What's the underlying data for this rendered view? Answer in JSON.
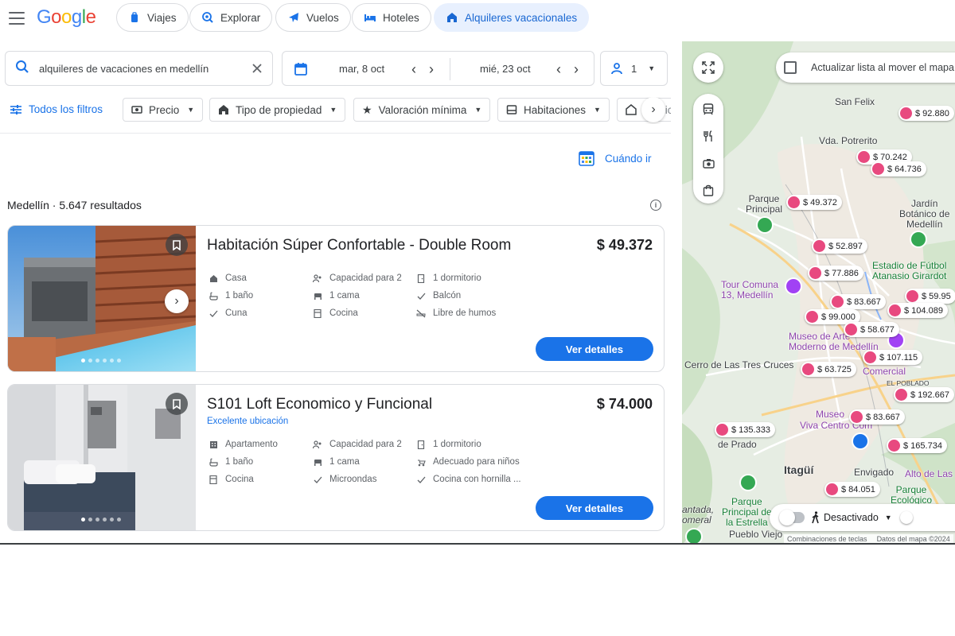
{
  "header": {
    "logo": "Google",
    "nav": [
      {
        "label": "Viajes",
        "icon": "suitcase-icon"
      },
      {
        "label": "Explorar",
        "icon": "explore-icon"
      },
      {
        "label": "Vuelos",
        "icon": "plane-icon"
      },
      {
        "label": "Hoteles",
        "icon": "bed-icon"
      },
      {
        "label": "Alquileres vacacionales",
        "icon": "house-icon",
        "active": true
      }
    ]
  },
  "search": {
    "query": "alquileres de vacaciones en medellín",
    "check_in": "mar, 8 oct",
    "check_out": "mié, 23 oct",
    "guests": "1"
  },
  "filters": {
    "all": "Todos los filtros",
    "items": [
      "Precio",
      "Tipo de propiedad",
      "Valoración mínima",
      "Habitaciones",
      "Servic"
    ]
  },
  "when_to_go": "Cuándo ir",
  "results": {
    "title": "Medellín · 5.647 resultados"
  },
  "listings": [
    {
      "title": "Habitación Súper Confortable - Double Room",
      "subtitle": "",
      "price": "$ 49.372",
      "amenities": [
        [
          "Casa",
          "Capacidad para 2",
          "1 dormitorio"
        ],
        [
          "1 baño",
          "1 cama",
          "Balcón"
        ],
        [
          "Cuna",
          "Cocina",
          "Libre de humos"
        ]
      ],
      "button": "Ver detalles"
    },
    {
      "title": "S101 Loft Economico y Funcional",
      "subtitle": "Excelente ubicación",
      "price": "$ 74.000",
      "amenities": [
        [
          "Apartamento",
          "Capacidad para 2",
          "1 dormitorio"
        ],
        [
          "1 baño",
          "1 cama",
          "Adecuado para niños"
        ],
        [
          "Cocina",
          "Microondas",
          "Cocina con hornilla ..."
        ]
      ],
      "button": "Ver detalles"
    }
  ],
  "map": {
    "update_label": "Actualizar lista al mover el mapa",
    "toggle_label": "Desactivado",
    "footer": [
      "Combinaciones de teclas",
      "Datos del mapa ©2024"
    ],
    "pins": [
      "$ 92.880",
      "$ 70.242",
      "$ 64.736",
      "$ 49.372",
      "$ 52.897",
      "$ 77.886",
      "$ 59.95",
      "$ 83.667",
      "$ 104.089",
      "$ 99.000",
      "$ 58.677",
      "$ 107.115",
      "$ 63.725",
      "$ 192.667",
      "$ 83.667",
      "$ 135.333",
      "$ 165.734",
      "$ 84.051"
    ],
    "labels": {
      "san_felix": "San Felix",
      "vda_potrerito": "Vda. Potrerito",
      "parque_principal": "Parque\nPrincipal",
      "jardin": "Jardín\nBotánico de\nMedellín",
      "estadio": "Estadio de Fútbol\nAtanasio Girardot",
      "tour_comuna": "Tour Comuna\n13, Medellín",
      "museo_moderno": "Museo de Arte\nModerno de Medellín",
      "cerro": "Cerro de Las Tres Cruces",
      "comercial": "Comercial",
      "poblado": "EL POBLADO",
      "viva": "Viva Centro Com",
      "museo2": "Museo",
      "de_prado": "de Prado",
      "itagui": "Itagüí",
      "envigado": "Envigado",
      "alto": "Alto de Las",
      "parque_eco": "Parque\nEcológico",
      "parque_estrella": "Parque\nPrincipal de\nla Estrella",
      "pueblo_viejo": "Pueblo Viejo",
      "antada": "antada,\nomeral"
    }
  },
  "colors": {
    "accent": "#1a73e8",
    "active_chip_bg": "#e8f0fe",
    "pin": "#e8497f"
  }
}
